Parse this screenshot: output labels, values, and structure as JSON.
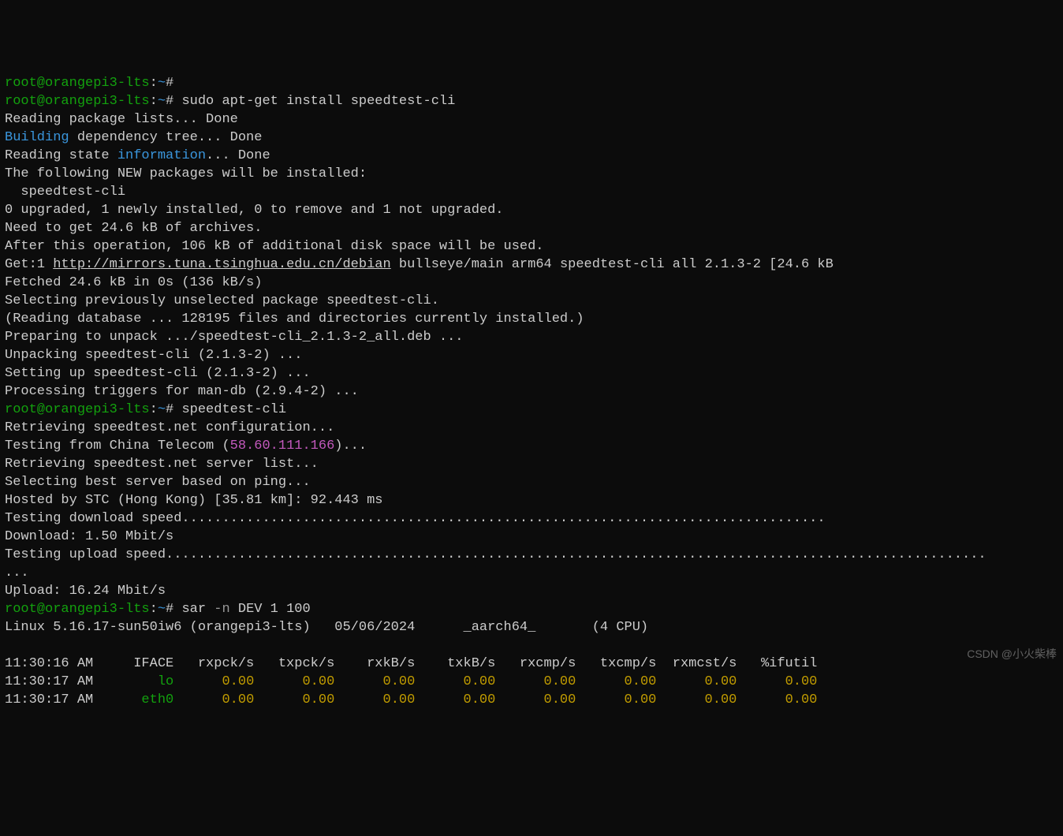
{
  "prompt_user": "root@orangepi3-lts",
  "prompt_path": "~",
  "prompt_symbol": "#",
  "cmd1": "",
  "cmd2": "sudo apt-get install speedtest-cli",
  "apt": {
    "l1": "Reading package lists... Done",
    "l2a": "Building",
    "l2b": " dependency tree... Done",
    "l3a": "Reading state ",
    "l3b": "information",
    "l3c": "... Done",
    "l4": "The following NEW packages will be installed:",
    "l5": "  speedtest-cli",
    "l6": "0 upgraded, 1 newly installed, 0 to remove and 1 not upgraded.",
    "l7": "Need to get 24.6 kB of archives.",
    "l8": "After this operation, 106 kB of additional disk space will be used.",
    "l9a": "Get:1 ",
    "l9b": "http://mirrors.tuna.tsinghua.edu.cn/debian",
    "l9c": " bullseye/main arm64 speedtest-cli all 2.1.3-2 [24.6 kB",
    "l10": "Fetched 24.6 kB in 0s (136 kB/s)",
    "l11": "Selecting previously unselected package speedtest-cli.",
    "l12": "(Reading database ... 128195 files and directories currently installed.)",
    "l13": "Preparing to unpack .../speedtest-cli_2.1.3-2_all.deb ...",
    "l14": "Unpacking speedtest-cli (2.1.3-2) ...",
    "l15": "Setting up speedtest-cli (2.1.3-2) ...",
    "l16": "Processing triggers for man-db (2.9.4-2) ..."
  },
  "cmd3": "speedtest-cli",
  "speed": {
    "s1": "Retrieving speedtest.net configuration...",
    "s2a": "Testing from China Telecom (",
    "s2b": "58.60.111.166",
    "s2c": ")...",
    "s3": "Retrieving speedtest.net server list...",
    "s4": "Selecting best server based on ping...",
    "s5": "Hosted by STC (Hong Kong) [35.81 km]: 92.443 ms",
    "s6": "Testing download speed................................................................................",
    "s7": "Download: 1.50 Mbit/s",
    "s8": "Testing upload speed......................................................................................................",
    "s9": "...",
    "s10": "Upload: 16.24 Mbit/s"
  },
  "cmd4a": "sar ",
  "cmd4b": "-n",
  "cmd4c": " DEV 1 100",
  "sar": {
    "header": "Linux 5.16.17-sun50iw6 (orangepi3-lts)   05/06/2024      _aarch64_       (4 CPU)",
    "cols": "11:30:16 AM     IFACE   rxpck/s   txpck/s    rxkB/s    txkB/s   rxcmp/s   txcmp/s  rxmcst/s   %ifutil",
    "r1t": "11:30:17 AM",
    "r1if": "        lo",
    "r1v": "      0.00      0.00      0.00      0.00      0.00      0.00      0.00      0.00",
    "r2t": "11:30:17 AM",
    "r2if": "      eth0",
    "r2v": "      0.00      0.00      0.00      0.00      0.00      0.00      0.00      0.00"
  },
  "watermark": "CSDN @小火柴棒"
}
